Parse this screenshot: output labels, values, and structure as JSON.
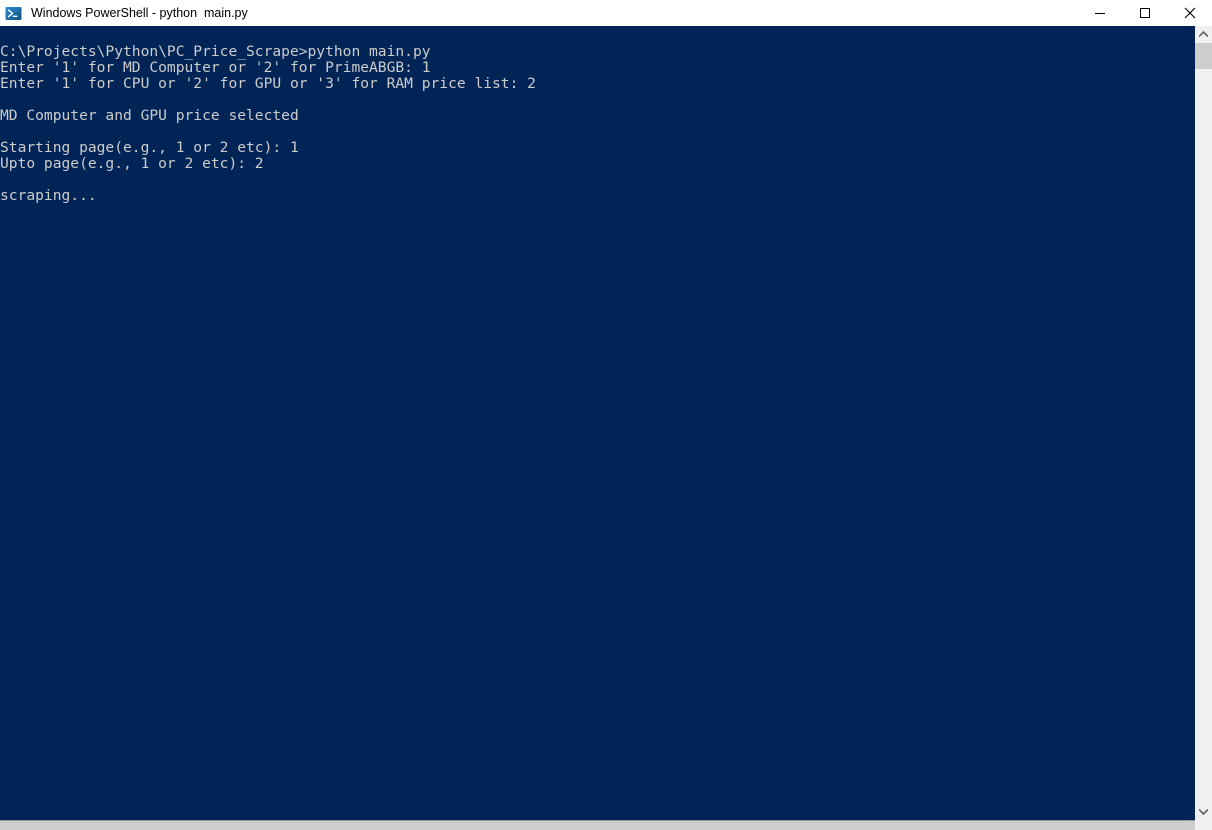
{
  "window": {
    "title": "Windows PowerShell - python  main.py",
    "app_icon": "powershell-icon",
    "background_color": "#012456",
    "foreground_color": "#cccccc",
    "titlebar_background": "#ffffff",
    "titlebar_foreground": "#000000"
  },
  "titlebar": {
    "minimize_label": "minimize-icon",
    "maximize_label": "maximize-icon",
    "close_label": "close-icon"
  },
  "console": {
    "prompt_path": "C:\\Projects\\Python\\PC_Price_Scrape",
    "command": "python main.py",
    "lines": [
      "C:\\Projects\\Python\\PC_Price_Scrape>python main.py",
      "Enter '1' for MD Computer or '2' for PrimeABGB: 1",
      "Enter '1' for CPU or '2' for GPU or '3' for RAM price list: 2",
      "",
      "MD Computer and GPU price selected",
      "",
      "Starting page(e.g., 1 or 2 etc): 1",
      "Upto page(e.g., 1 or 2 etc): 2",
      "",
      "scraping..."
    ],
    "text": "C:\\Projects\\Python\\PC_Price_Scrape>python main.py\nEnter '1' for MD Computer or '2' for PrimeABGB: 1\nEnter '1' for CPU or '2' for GPU or '3' for RAM price list: 2\n\nMD Computer and GPU price selected\n\nStarting page(e.g., 1 or 2 etc): 1\nUpto page(e.g., 1 or 2 etc): 2\n\nscraping..."
  },
  "scrollbars": {
    "vertical": {
      "up_arrow": "scroll-up-icon",
      "down_arrow": "scroll-down-icon",
      "track_color": "#f0f0f0",
      "thumb_color": "#cdcdcd"
    },
    "horizontal": {
      "track_color": "#d8d8d8",
      "thumb_color": "#cdcdcd"
    }
  }
}
